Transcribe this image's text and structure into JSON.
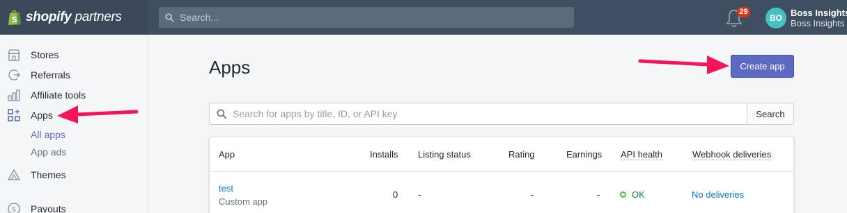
{
  "brand": {
    "bold": "shopify",
    "light": "partners"
  },
  "search": {
    "placeholder": "Search..."
  },
  "notifications": {
    "count": "29"
  },
  "user": {
    "initials": "BO",
    "name": "Boss Insights",
    "org": "Boss Insights"
  },
  "sidebar": {
    "items": [
      {
        "label": "Stores",
        "icon": "store-icon"
      },
      {
        "label": "Referrals",
        "icon": "referral-icon"
      },
      {
        "label": "Affiliate tools",
        "icon": "chart-icon"
      },
      {
        "label": "Apps",
        "icon": "apps-icon"
      },
      {
        "label": "Themes",
        "icon": "themes-icon"
      },
      {
        "label": "Payouts",
        "icon": "payouts-icon"
      }
    ],
    "apps_sub": {
      "all_apps": "All apps",
      "app_ads": "App ads"
    }
  },
  "main": {
    "title": "Apps",
    "create_button": "Create app",
    "app_search": {
      "placeholder": "Search for apps by title, ID, or API key",
      "button": "Search"
    },
    "table": {
      "headers": [
        "App",
        "Installs",
        "Listing status",
        "Rating",
        "Earnings",
        "API health",
        "Webhook deliveries"
      ],
      "rows": [
        {
          "name": "test",
          "type": "Custom app",
          "installs": "0",
          "listing_status": "-",
          "rating": "-",
          "earnings": "-",
          "api_health": "OK",
          "webhooks": "No deliveries"
        }
      ]
    }
  },
  "colors": {
    "topbar": "#3f4e60",
    "accent": "#5c6ac4",
    "link": "#007ace",
    "ok": "#50b83c",
    "annotation": "#f5145a"
  }
}
